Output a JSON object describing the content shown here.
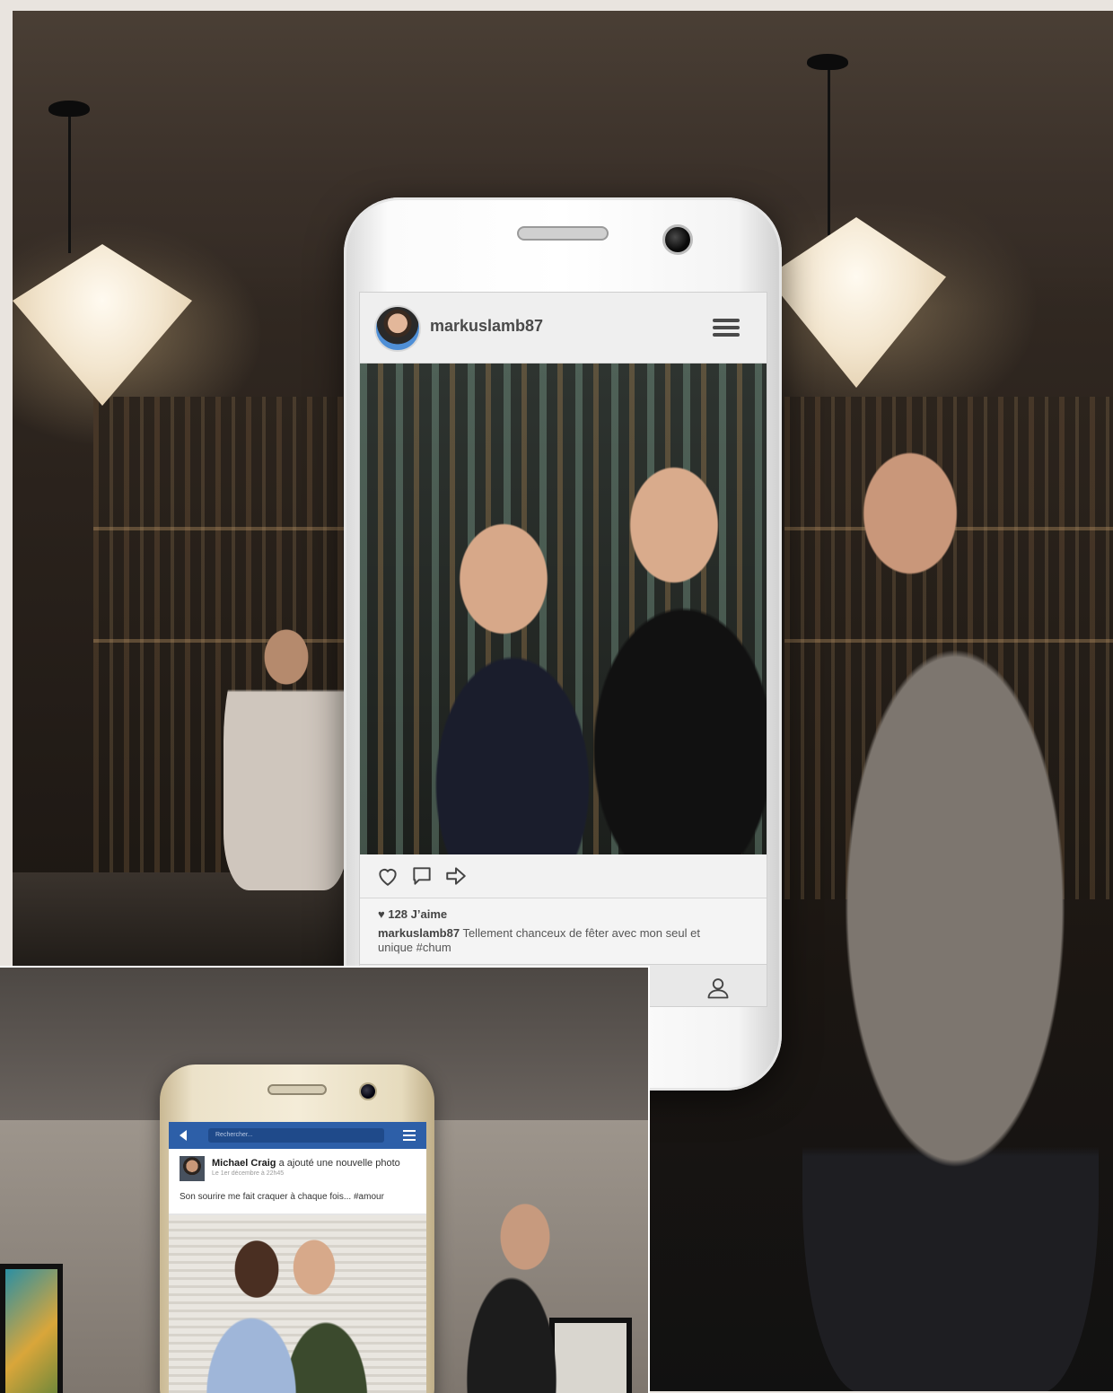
{
  "instagram": {
    "username": "markuslamb87",
    "likes": "128 J’aime",
    "caption_user": "markuslamb87",
    "caption_text": "Tellement chanceux de fêter avec mon seul et unique #chum",
    "icons": [
      "heart-icon",
      "comment-icon",
      "share-icon",
      "menu-icon",
      "profile-icon"
    ]
  },
  "facebook": {
    "search_placeholder": "Rechercher...",
    "poster_name": "Michael Craig",
    "action_text": "a ajouté une nouvelle photo",
    "timestamp": "Le 1er décembre à 22h45",
    "post_text": "Son sourire me fait craquer à chaque fois... #amour",
    "header_color": "#2d5fa8"
  }
}
